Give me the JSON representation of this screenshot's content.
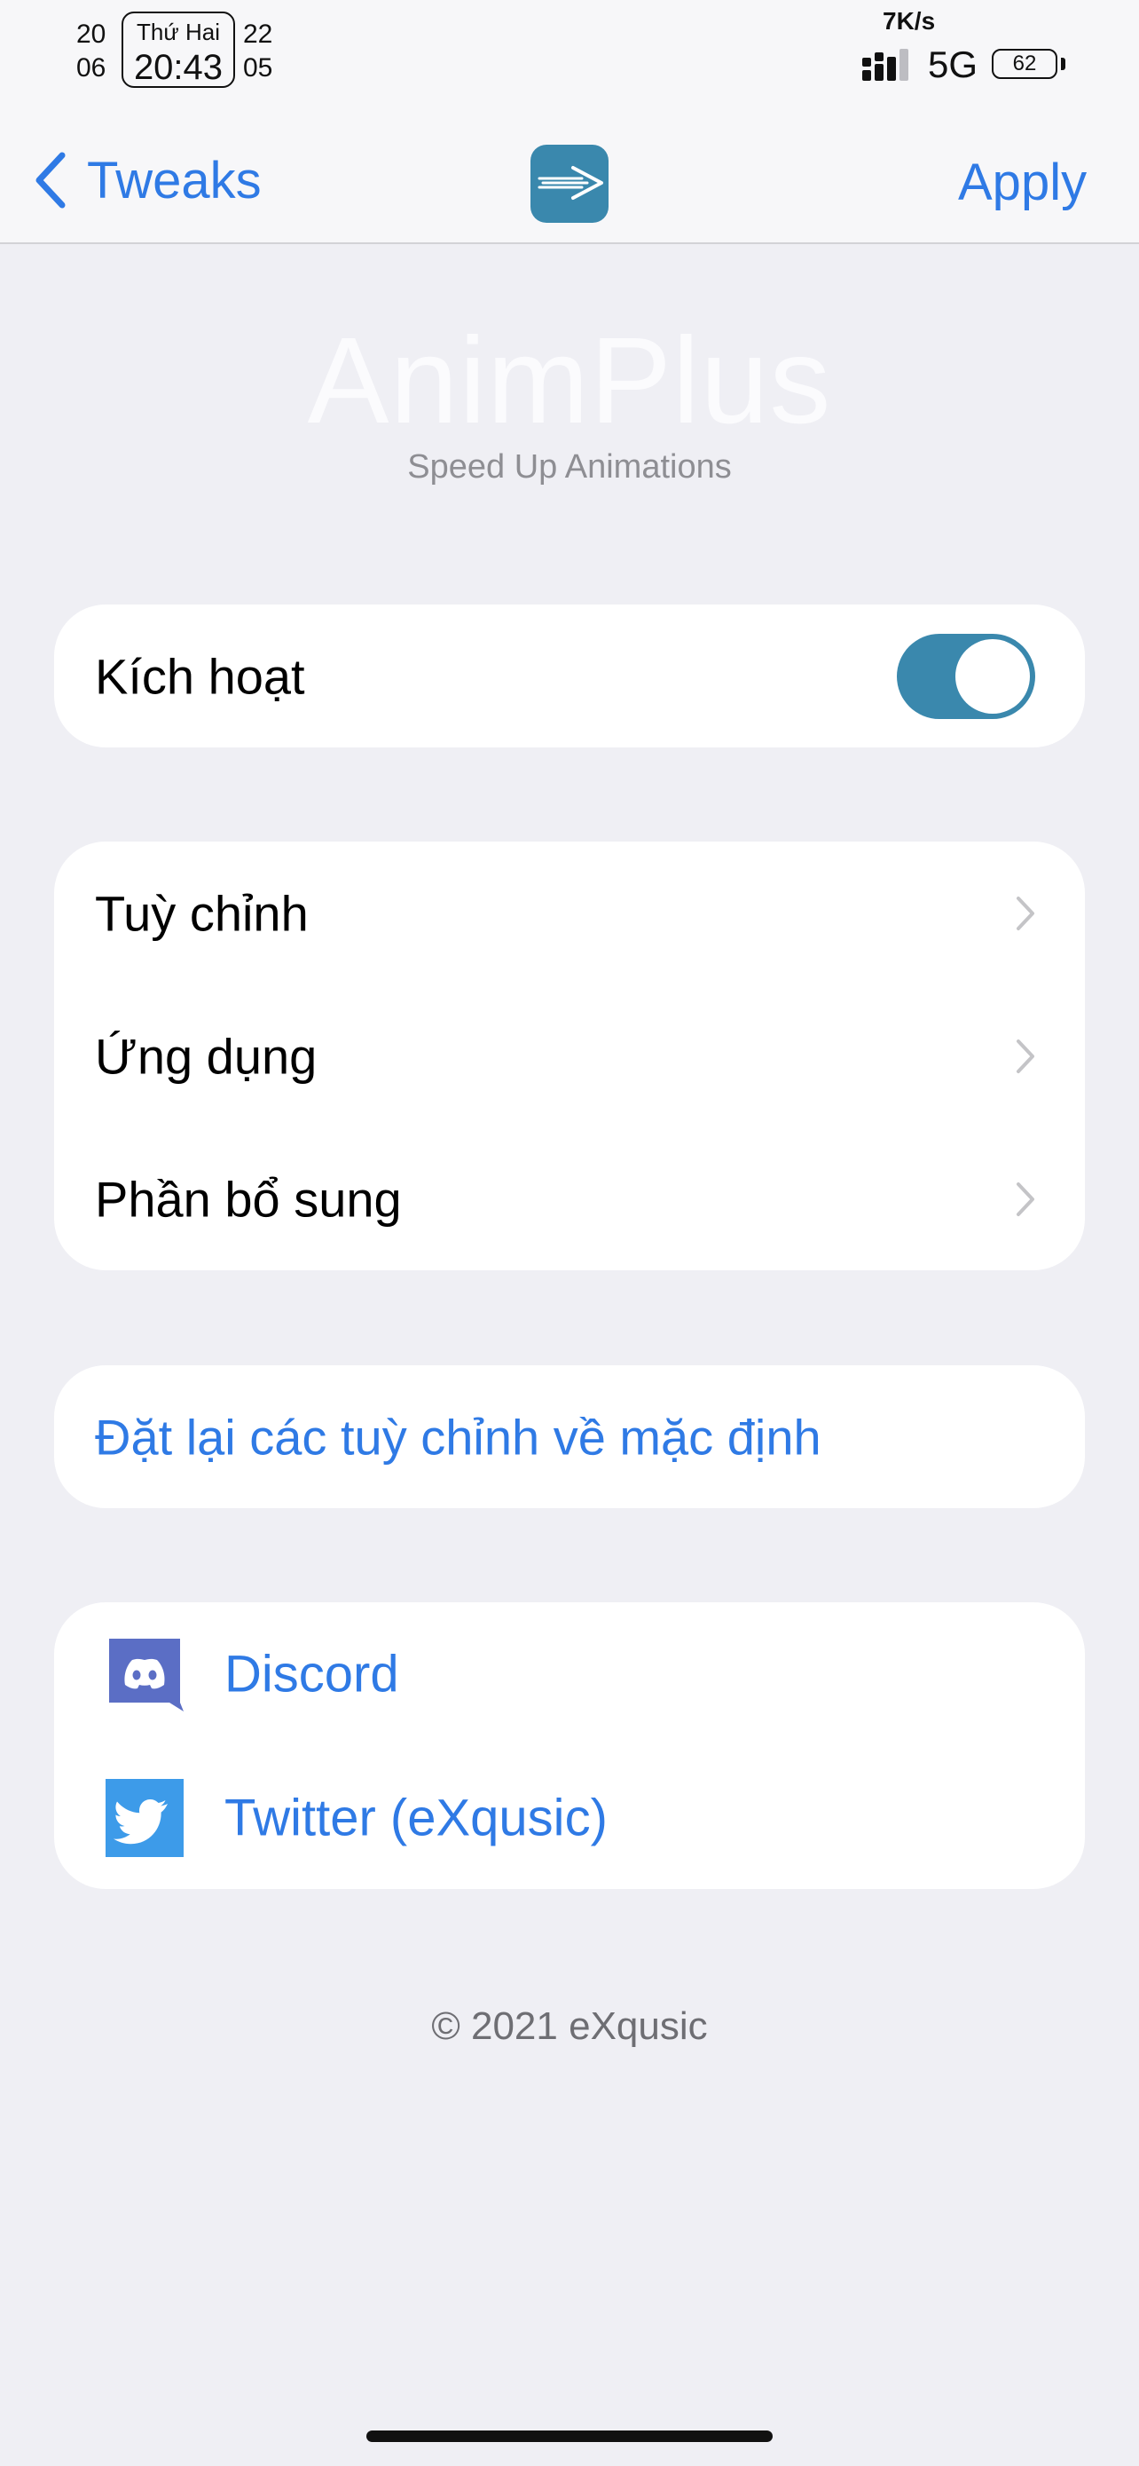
{
  "status_bar": {
    "date_left_top": "20",
    "date_left_bottom": "06",
    "weekday": "Thứ Hai",
    "time": "20:43",
    "date_right_top": "22",
    "date_right_bottom": "05",
    "net_speed": "7K/s",
    "network": "5G",
    "battery": "62"
  },
  "nav": {
    "back_label": "Tweaks",
    "apply_label": "Apply"
  },
  "header": {
    "title": "AnimPlus",
    "subtitle": "Speed Up Animations"
  },
  "enable_card": {
    "label": "Kích hoạt",
    "enabled": true
  },
  "menu_card": {
    "items": [
      {
        "label": "Tuỳ chỉnh"
      },
      {
        "label": "Ứng dụng"
      },
      {
        "label": "Phần bổ sung"
      }
    ]
  },
  "reset_card": {
    "label": "Đặt lại các tuỳ chỉnh về mặc định"
  },
  "links_card": {
    "items": [
      {
        "label": "Discord",
        "icon": "discord-icon",
        "color": "#5b6ec5"
      },
      {
        "label": "Twitter (eXqusic)",
        "icon": "twitter-icon",
        "color": "#3d9be9"
      }
    ]
  },
  "footer": {
    "copyright": "© 2021 eXqusic"
  },
  "colors": {
    "accent": "#2f7ae5",
    "toggle_on": "#3a88ad",
    "background": "#efeff4"
  }
}
